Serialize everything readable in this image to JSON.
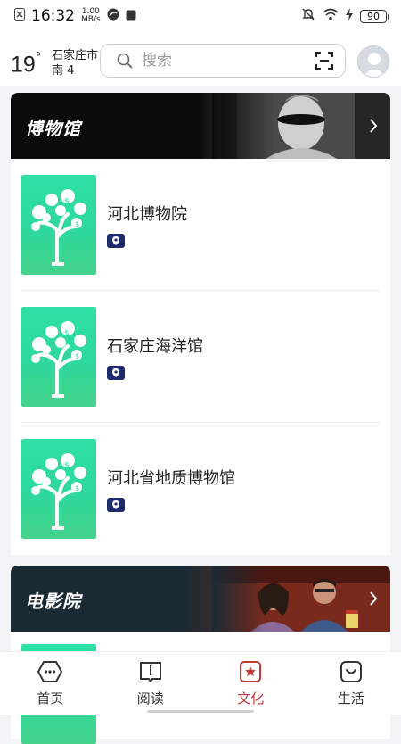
{
  "status_bar": {
    "time": "16:32",
    "net_speed": "1.00",
    "net_unit": "MB/s",
    "battery": "90"
  },
  "header": {
    "temperature": "19",
    "degree_symbol": "°",
    "city": "石家庄市",
    "wind": "南 4"
  },
  "search": {
    "placeholder": "搜索"
  },
  "sections": [
    {
      "title": "博物馆",
      "items": [
        {
          "name": "河北博物院"
        },
        {
          "name": "石家庄海洋馆"
        },
        {
          "name": "河北省地质博物馆"
        }
      ]
    },
    {
      "title": "电影院"
    }
  ],
  "bottom_nav": [
    {
      "label": "首页",
      "icon": "home-icon"
    },
    {
      "label": "阅读",
      "icon": "book-icon"
    },
    {
      "label": "文化",
      "icon": "culture-icon",
      "active": true
    },
    {
      "label": "生活",
      "icon": "life-icon"
    }
  ],
  "colors": {
    "accent": "#c0393b",
    "thumb_green": "#2ee0a6"
  }
}
